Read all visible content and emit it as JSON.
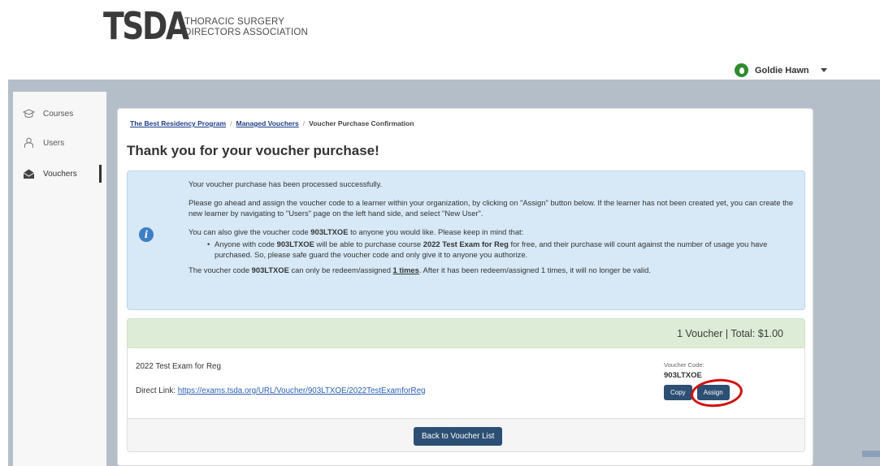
{
  "logo": {
    "mark": "TSDA",
    "line1": "THORACIC SURGERY",
    "line2": "DIRECTORS ASSOCIATION"
  },
  "user": {
    "name": "Goldie Hawn"
  },
  "sidebar": {
    "items": [
      {
        "label": "Courses",
        "icon": "courses-icon"
      },
      {
        "label": "Users",
        "icon": "users-icon"
      },
      {
        "label": "Vouchers",
        "icon": "vouchers-icon",
        "active": true
      }
    ]
  },
  "breadcrumb": {
    "items": [
      {
        "label": "The Best Residency Program",
        "link": true
      },
      {
        "label": "Managed Vouchers",
        "link": true
      },
      {
        "label": "Voucher Purchase Confirmation",
        "link": false
      }
    ],
    "separator": "/"
  },
  "page": {
    "title": "Thank you for your voucher purchase!"
  },
  "info": {
    "p1": "Your voucher purchase has been processed successfully.",
    "p2": "Please go ahead and assign the voucher code to a learner within your organization, by clicking on \"Assign\" button below. If the learner has not been created yet, you can create the new learner by navigating to \"Users\" page on the left hand side, and select \"New User\".",
    "p3_pre": "You can also give the voucher code ",
    "code": "903LTXOE",
    "p3_post": " to anyone you would like. Please keep in mind that:",
    "bullet_pre": "Anyone with code ",
    "bullet_mid": " will be able to purchase course ",
    "course": "2022 Test Exam for Reg",
    "bullet_post": " for free, and their purchase will count against the number of usage you have purchased. So, please safe guard the voucher code and only give it to anyone you authorize.",
    "p4_pre": "The voucher code ",
    "p4_mid": " can only be redeem/assigned ",
    "times": "1 times",
    "p4_post": ". After it has been redeem/assigned 1 times, it will no longer be valid."
  },
  "summary": {
    "text": "1 Voucher | Total: $1.00"
  },
  "item": {
    "name": "2022 Test Exam for Reg",
    "link_label": "Direct Link: ",
    "link_url": "https://exams.tsda.org/URL/Voucher/903LTXOE/2022TestExamforReg",
    "voucher_label": "Voucher Code:",
    "voucher_code": "903LTXOE",
    "copy_label": "Copy",
    "assign_label": "Assign"
  },
  "footer": {
    "back_label": "Back to Voucher List"
  },
  "colors": {
    "primary_button": "#2c4f73",
    "info_bg": "#d7e9f6",
    "summary_bg": "#dcecd6",
    "highlight_circle": "#d01010"
  }
}
